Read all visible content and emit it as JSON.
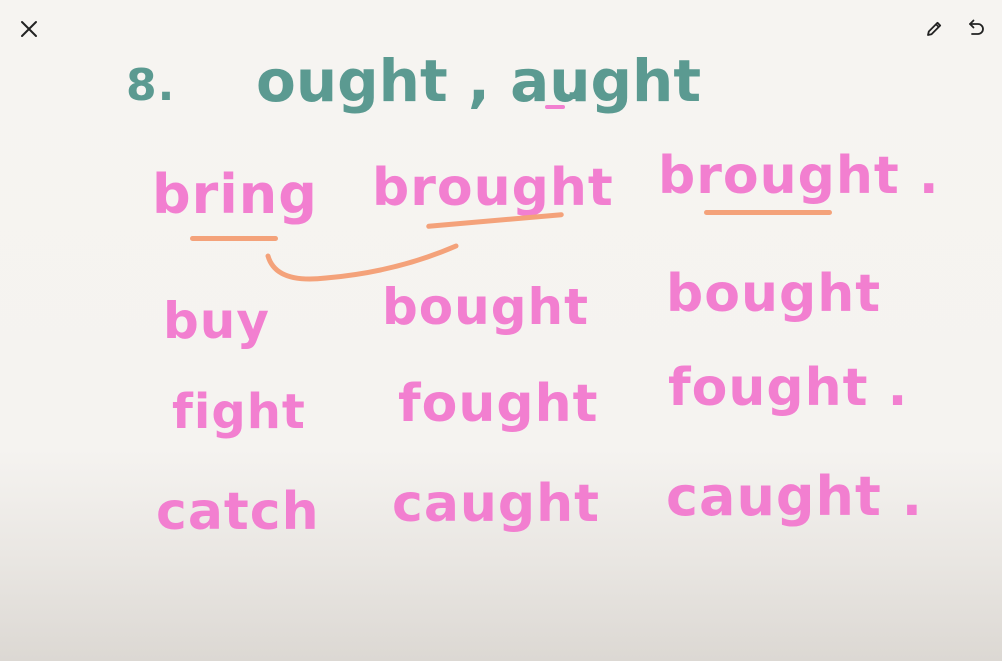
{
  "toolbar": {
    "close_icon": "close-icon",
    "edit_icon": "pencil-icon",
    "undo_icon": "undo-icon",
    "icon_color": "#222222"
  },
  "heading": {
    "number": "8.",
    "text": "ought , aught",
    "period": "."
  },
  "colors": {
    "title": "#5b9a91",
    "words": "#f27fd0",
    "underline": "#f4a27a"
  },
  "columns": {
    "base": [
      "bring",
      "buy",
      "fight",
      "catch"
    ],
    "past": [
      "brought",
      "bought",
      "fought",
      "caught"
    ],
    "participle": [
      "brought .",
      "bought",
      "fought .",
      "caught ."
    ]
  }
}
